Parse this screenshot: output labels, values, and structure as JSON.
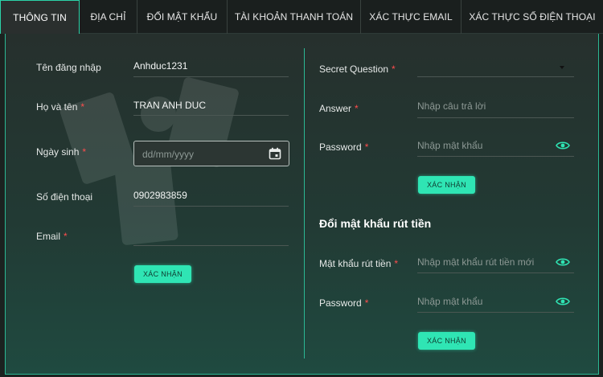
{
  "tabs": [
    {
      "label": "THÔNG TIN"
    },
    {
      "label": "ĐỊA CHỈ"
    },
    {
      "label": "ĐỔI MẬT KHẨU"
    },
    {
      "label": "TÀI KHOẢN THANH TOÁN"
    },
    {
      "label": "XÁC THỰC EMAIL"
    },
    {
      "label": "XÁC THỰC SỐ ĐIỆN THOẠI"
    }
  ],
  "profile": {
    "username_label": "Tên đăng nhập",
    "username_value": "Anhduc1231",
    "fullname_label": "Họ và tên",
    "fullname_value": "TRAN ANH DUC",
    "birthday_label": "Ngày sinh",
    "birthday_placeholder": "dd/mm/yyyy",
    "phone_label": "Số điện thoại",
    "phone_value": "0902983859",
    "email_label": "Email",
    "email_value": "",
    "submit_label": "XÁC NHẬN"
  },
  "security": {
    "question_label": "Secret Question",
    "question_value": "",
    "answer_label": "Answer",
    "answer_placeholder": "Nhập câu trả lời",
    "password_label": "Password",
    "password_placeholder": "Nhập mật khẩu",
    "submit_label": "XÁC NHẬN"
  },
  "withdraw": {
    "title": "Đổi mật khẩu rút tiền",
    "new_label": "Mật khẩu rút tiền",
    "new_placeholder": "Nhập mật khẩu rút tiền mới",
    "password_label": "Password",
    "password_placeholder": "Nhập mật khẩu",
    "submit_label": "XÁC NHẬN"
  },
  "required_mark": "*",
  "colors": {
    "accent": "#2fe5b4",
    "border": "#2bb894",
    "required": "#ff4d4d",
    "background": "#1b2220"
  },
  "icons": [
    "calendar-icon",
    "eye-icon",
    "chevron-down-icon"
  ]
}
